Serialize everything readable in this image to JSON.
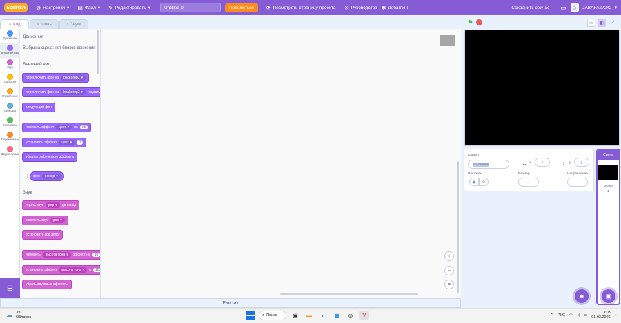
{
  "menubar": {
    "logo": "Scratch",
    "settings": "Настройки",
    "file": "Файл",
    "edit": "Редактировать",
    "project_title": "Untitled-9",
    "share": "Поделиться",
    "see_project_page": "Посмотреть страницу проекта",
    "tutorials": "Руководства",
    "debugging": "Дебаггинг",
    "save_now": "Сохранить сейчас",
    "username": "DABAFA27242"
  },
  "tabs": [
    {
      "label": "Код",
      "icon": "code-icon"
    },
    {
      "label": "Фоны",
      "icon": "brush-icon"
    },
    {
      "label": "Звуки",
      "icon": "speaker-icon"
    }
  ],
  "categories": [
    {
      "label": "Движение",
      "color": "#4c97ff"
    },
    {
      "label": "Внешний вид",
      "color": "#9966ff"
    },
    {
      "label": "Звук",
      "color": "#cf63cf"
    },
    {
      "label": "События",
      "color": "#ffbf00"
    },
    {
      "label": "Управление",
      "color": "#ffab19"
    },
    {
      "label": "Сенсоры",
      "color": "#5cb1d6"
    },
    {
      "label": "Операторы",
      "color": "#59c059"
    },
    {
      "label": "Переменные",
      "color": "#ff8c1a"
    },
    {
      "label": "Другие блоки",
      "color": "#ff6680"
    }
  ],
  "palette": {
    "motion_heading": "Движение",
    "motion_note": "Выбрана сцена: нет блоков движения",
    "looks_heading": "Внешний вид",
    "b1": "переключить фон на",
    "b1_dd": "backdrop2",
    "b2": "переключить фон на",
    "b2_dd": "backdrop2",
    "b2_tail": "и ждать",
    "b3": "следующий фон",
    "b4": "изменить эффект",
    "b4_dd": "цвет",
    "b4_mid": "на",
    "b4_val": "25",
    "b5": "установить эффект",
    "b5_dd": "цвет",
    "b5_val": "0",
    "b6": "убрать графические эффекты",
    "b7_dd": "фон",
    "b7_dd2": "номер",
    "sound_heading": "Звук",
    "s1": "играть звук",
    "s1_dd": "pop",
    "s1_tail": "до конца",
    "s2": "включить звук",
    "s2_dd": "pop",
    "s3": "остановить все звуки",
    "s4": "изменить",
    "s4_dd": "высота тона",
    "s4_mid": "эффект на",
    "s4_val": "10",
    "s5": "установить эффект",
    "s5_dd": "высота тона",
    "s5_mid": "в",
    "s5_val": "100",
    "s6": "убрать звуковые эффекты"
  },
  "workspace": {
    "zoom_in": "+",
    "zoom_out": "−",
    "zoom_reset": "="
  },
  "backpack": "Рюкзак",
  "sprite_panel": {
    "sprite_label": "Спрайт",
    "name_placeholder": "Название",
    "x_label": "x",
    "x_value": "x",
    "y_label": "y",
    "y_value": "y",
    "show_label": "Показать",
    "size_label": "Размер",
    "direction_label": "Направление"
  },
  "stage_pane": {
    "header": "Сцена",
    "backdrops_label": "Фоны",
    "backdrops_count": "1"
  },
  "taskbar": {
    "temperature": "3°C",
    "condition": "Облачно",
    "search": "Поиск",
    "lang": "РУС",
    "time": "13:03",
    "date": "01.03.2026"
  }
}
